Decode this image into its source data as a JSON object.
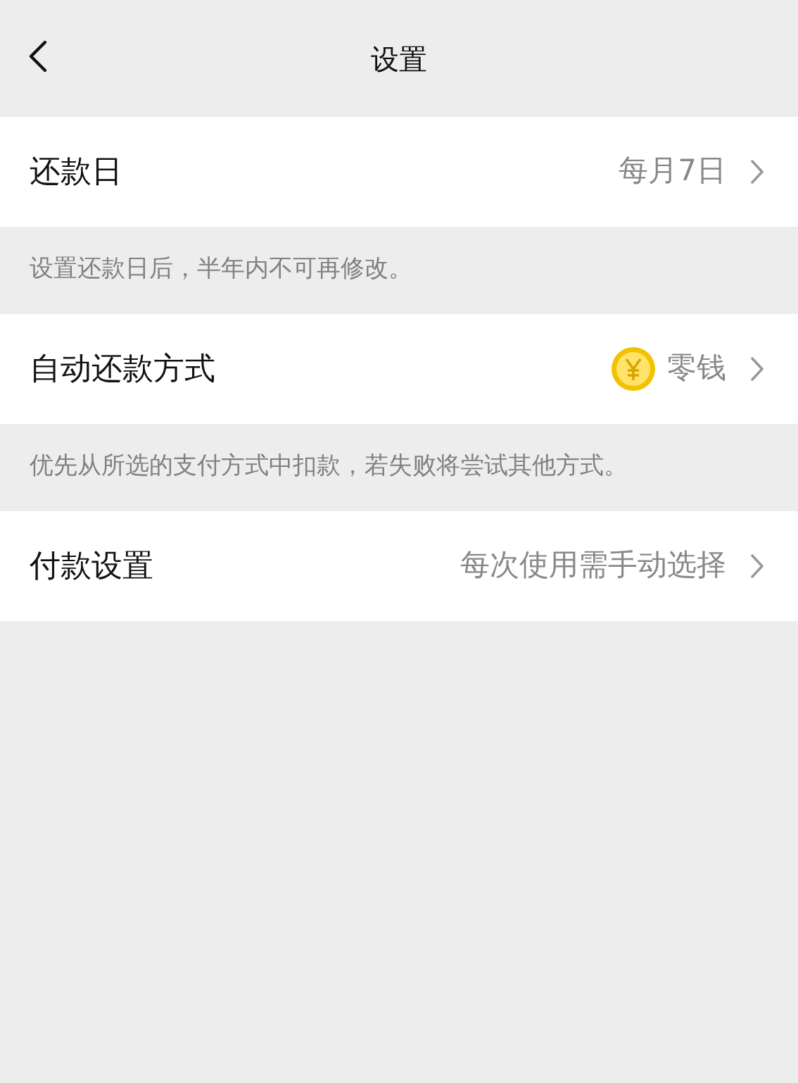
{
  "header": {
    "title": "设置"
  },
  "settings": [
    {
      "label": "还款日",
      "value": "每月7日",
      "kind": "plain",
      "note": "设置还款日后，半年内不可再修改。"
    },
    {
      "label": "自动还款方式",
      "value": "零钱",
      "kind": "coin",
      "note": "优先从所选的支付方式中扣款，若失败将尝试其他方式。"
    },
    {
      "label": "付款设置",
      "value": "每次使用需手动选择",
      "kind": "plain"
    }
  ]
}
